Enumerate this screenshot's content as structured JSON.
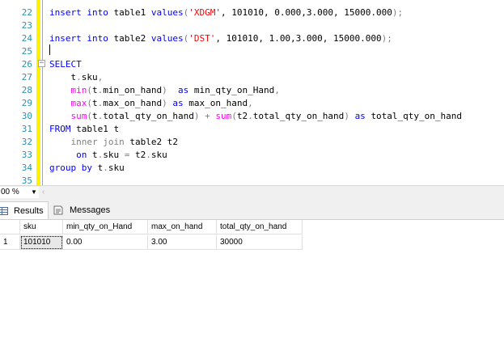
{
  "editor": {
    "line_numbers": [
      "22",
      "23",
      "24",
      "25",
      "26",
      "27",
      "28",
      "29",
      "30",
      "31",
      "32",
      "33",
      "34",
      "35"
    ],
    "lines": [
      [
        {
          "t": "insert into ",
          "c": "kw"
        },
        {
          "t": "table1 ",
          "c": ""
        },
        {
          "t": "values",
          "c": "kw"
        },
        {
          "t": "(",
          "c": "gr"
        },
        {
          "t": "'XDGM'",
          "c": "str"
        },
        {
          "t": ", 101010, 0.000,3.000, 15000.000",
          "c": ""
        },
        {
          "t": ");",
          "c": "gr"
        }
      ],
      [],
      [
        {
          "t": "insert into ",
          "c": "kw"
        },
        {
          "t": "table2 ",
          "c": ""
        },
        {
          "t": "values",
          "c": "kw"
        },
        {
          "t": "(",
          "c": "gr"
        },
        {
          "t": "'DST'",
          "c": "str"
        },
        {
          "t": ", 101010, 1.00,3.000, 15000.000",
          "c": ""
        },
        {
          "t": ");",
          "c": "gr"
        }
      ],
      [],
      [
        {
          "t": "SELECT",
          "c": "kw"
        }
      ],
      [
        {
          "t": "    t",
          "c": ""
        },
        {
          "t": ".",
          "c": "gr"
        },
        {
          "t": "sku",
          "c": ""
        },
        {
          "t": ",",
          "c": "gr"
        }
      ],
      [
        {
          "t": "    ",
          "c": ""
        },
        {
          "t": "min",
          "c": "fn"
        },
        {
          "t": "(",
          "c": "gr"
        },
        {
          "t": "t",
          "c": ""
        },
        {
          "t": ".",
          "c": "gr"
        },
        {
          "t": "min_on_hand",
          "c": ""
        },
        {
          "t": ")",
          "c": "gr"
        },
        {
          "t": "  as ",
          "c": "kw"
        },
        {
          "t": "min_qty_on_Hand",
          "c": ""
        },
        {
          "t": ",",
          "c": "gr"
        }
      ],
      [
        {
          "t": "    ",
          "c": ""
        },
        {
          "t": "max",
          "c": "fn"
        },
        {
          "t": "(",
          "c": "gr"
        },
        {
          "t": "t",
          "c": ""
        },
        {
          "t": ".",
          "c": "gr"
        },
        {
          "t": "max_on_hand",
          "c": ""
        },
        {
          "t": ") ",
          "c": "gr"
        },
        {
          "t": "as ",
          "c": "kw"
        },
        {
          "t": "max_on_hand",
          "c": ""
        },
        {
          "t": ",",
          "c": "gr"
        }
      ],
      [
        {
          "t": "    ",
          "c": ""
        },
        {
          "t": "sum",
          "c": "fn"
        },
        {
          "t": "(",
          "c": "gr"
        },
        {
          "t": "t",
          "c": ""
        },
        {
          "t": ".",
          "c": "gr"
        },
        {
          "t": "total_qty_on_hand",
          "c": ""
        },
        {
          "t": ") + ",
          "c": "gr"
        },
        {
          "t": "sum",
          "c": "fn"
        },
        {
          "t": "(",
          "c": "gr"
        },
        {
          "t": "t2",
          "c": ""
        },
        {
          "t": ".",
          "c": "gr"
        },
        {
          "t": "total_qty_on_hand",
          "c": ""
        },
        {
          "t": ") ",
          "c": "gr"
        },
        {
          "t": "as ",
          "c": "kw"
        },
        {
          "t": "total_qty_on_hand",
          "c": ""
        }
      ],
      [
        {
          "t": "FROM ",
          "c": "kw"
        },
        {
          "t": "table1 t",
          "c": ""
        }
      ],
      [
        {
          "t": "    ",
          "c": ""
        },
        {
          "t": "inner join ",
          "c": "gr"
        },
        {
          "t": "table2 t2",
          "c": ""
        }
      ],
      [
        {
          "t": "     ",
          "c": ""
        },
        {
          "t": "on ",
          "c": "kw"
        },
        {
          "t": "t",
          "c": ""
        },
        {
          "t": ".",
          "c": "gr"
        },
        {
          "t": "sku ",
          "c": ""
        },
        {
          "t": "= ",
          "c": "gr"
        },
        {
          "t": "t2",
          "c": ""
        },
        {
          "t": ".",
          "c": "gr"
        },
        {
          "t": "sku",
          "c": ""
        }
      ],
      [
        {
          "t": "group by ",
          "c": "kw"
        },
        {
          "t": "t",
          "c": ""
        },
        {
          "t": ".",
          "c": "gr"
        },
        {
          "t": "sku",
          "c": ""
        }
      ],
      []
    ]
  },
  "zoom": {
    "value": "00 %"
  },
  "tabs": {
    "results": "Results",
    "messages": "Messages"
  },
  "grid": {
    "columns": [
      "sku",
      "min_qty_on_Hand",
      "max_on_hand",
      "total_qty_on_hand"
    ],
    "rows": [
      {
        "row_num": "1",
        "cells": [
          "101010",
          "0.00",
          "3.00",
          "30000"
        ]
      }
    ]
  }
}
